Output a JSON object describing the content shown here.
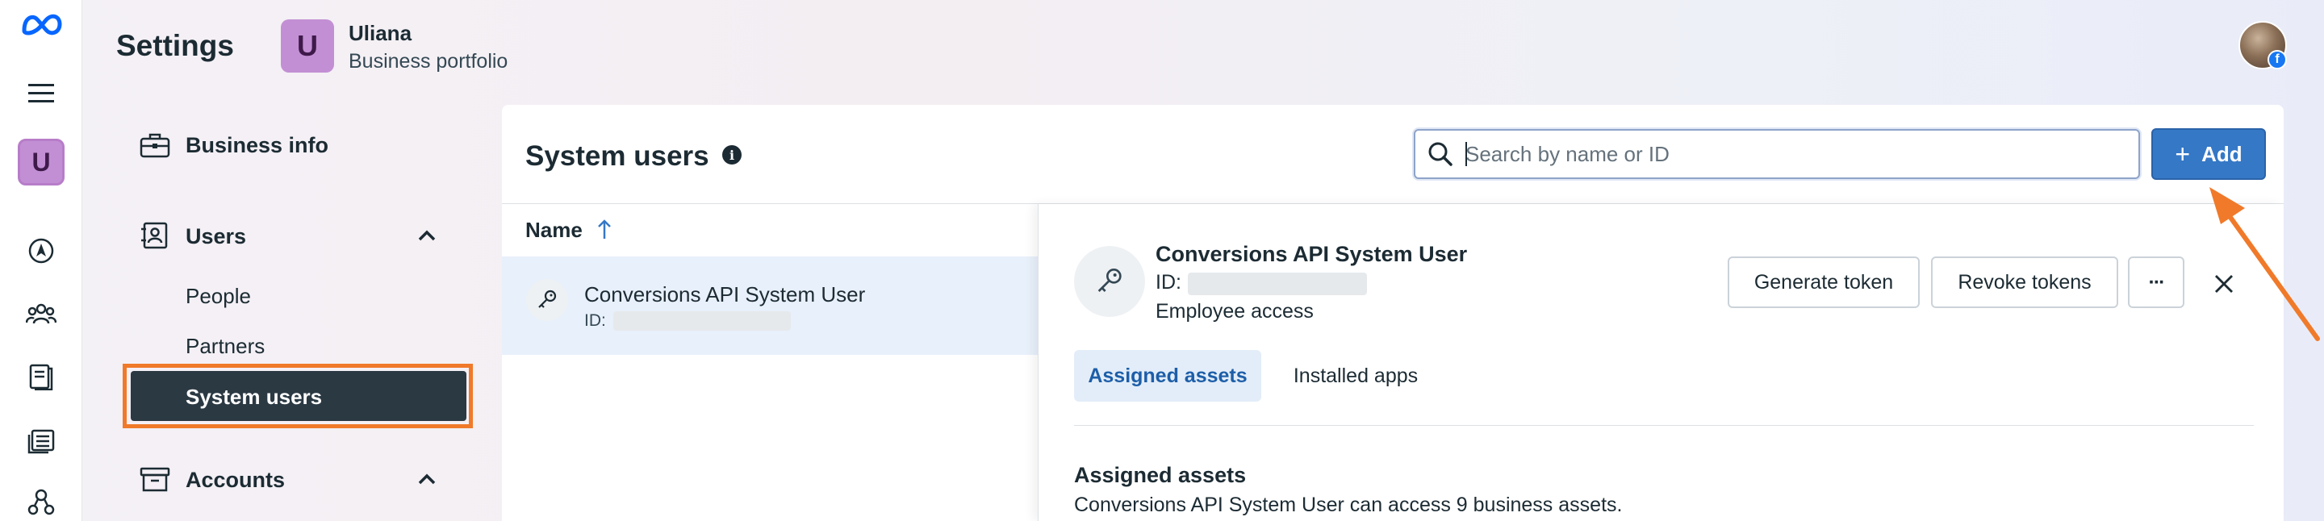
{
  "header": {
    "title": "Settings",
    "business_initial": "U",
    "business_name": "Uliana",
    "business_sub": "Business portfolio"
  },
  "rail": {
    "avatar_initial": "U",
    "icons": [
      "meta-logo-icon",
      "menu-icon",
      "navigation-icon",
      "people-icon",
      "catalog-icon",
      "pages-icon",
      "network-icon"
    ]
  },
  "sidebar": {
    "business_info": "Business info",
    "users": "Users",
    "people": "People",
    "partners": "Partners",
    "system_users": "System users",
    "accounts": "Accounts"
  },
  "main": {
    "title": "System users",
    "search_placeholder": "Search by name or ID",
    "add_label": "Add",
    "column_name": "Name",
    "rows": [
      {
        "name": "Conversions API System User",
        "id_label": "ID:"
      }
    ]
  },
  "detail": {
    "name": "Conversions API System User",
    "id_label": "ID:",
    "access": "Employee access",
    "generate_token": "Generate token",
    "revoke_tokens": "Revoke tokens",
    "more": "···",
    "tabs": [
      "Assigned assets",
      "Installed apps"
    ],
    "assets_heading": "Assigned assets",
    "assets_description": "Conversions API System User can access 9 business assets."
  },
  "colors": {
    "accent": "#3578c6",
    "highlight": "#f07a2a",
    "selected_nav": "#2b3943",
    "avatar": "#c38fd4"
  }
}
